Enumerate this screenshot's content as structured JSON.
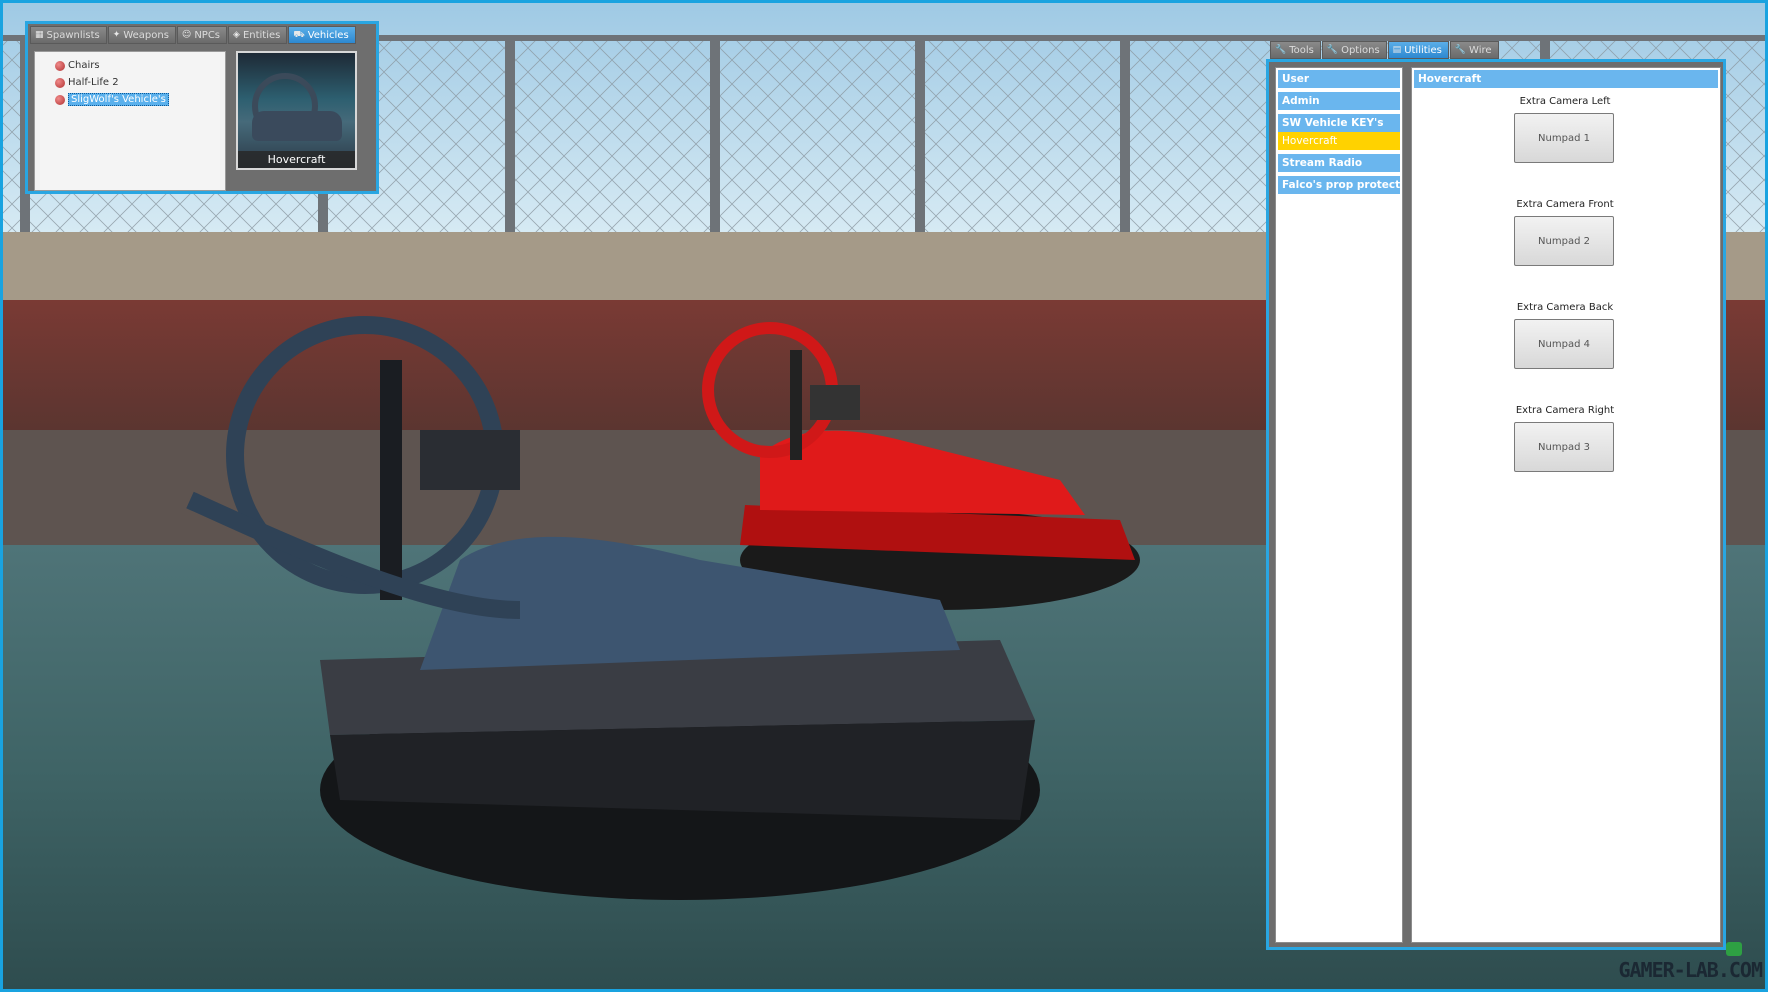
{
  "spawnmenu": {
    "tabs": [
      {
        "label": "Spawnlists",
        "icon": "grid-icon",
        "active": false
      },
      {
        "label": "Weapons",
        "icon": "weapon-icon",
        "active": false
      },
      {
        "label": "NPCs",
        "icon": "npc-icon",
        "active": false
      },
      {
        "label": "Entities",
        "icon": "entity-icon",
        "active": false
      },
      {
        "label": "Vehicles",
        "icon": "car-icon",
        "active": true
      }
    ],
    "tree": [
      {
        "label": "Chairs",
        "selected": false
      },
      {
        "label": "Half-Life 2",
        "selected": false
      },
      {
        "label": "SligWolf's Vehicle's",
        "selected": true
      }
    ],
    "thumbnail": {
      "label": "Hovercraft"
    }
  },
  "contextmenu": {
    "tabs": [
      {
        "label": "Tools",
        "icon": "wrench-icon",
        "active": false
      },
      {
        "label": "Options",
        "icon": "wrench-icon",
        "active": false
      },
      {
        "label": "Utilities",
        "icon": "page-icon",
        "active": true
      },
      {
        "label": "Wire",
        "icon": "wrench-icon",
        "active": false
      }
    ],
    "categories": [
      {
        "label": "User",
        "selected": false
      },
      {
        "label": "Admin",
        "selected": false
      },
      {
        "label": "SW Vehicle KEY's",
        "selected": false
      },
      {
        "label": "Hovercraft",
        "selected": true
      },
      {
        "label": "Stream Radio",
        "selected": false
      },
      {
        "label": "Falco's prop protect...",
        "selected": false
      }
    ],
    "settings": {
      "title": "Hovercraft",
      "bindings": [
        {
          "label": "Extra Camera Left",
          "key": "Numpad 1"
        },
        {
          "label": "Extra Camera Front",
          "key": "Numpad 2"
        },
        {
          "label": "Extra Camera Back",
          "key": "Numpad 4"
        },
        {
          "label": "Extra Camera Right",
          "key": "Numpad 3"
        }
      ]
    }
  },
  "watermark": "GAMER-LAB.COM",
  "colors": {
    "accent": "#29a6e2",
    "selected": "#ffd200",
    "category": "#6ab6ee"
  }
}
